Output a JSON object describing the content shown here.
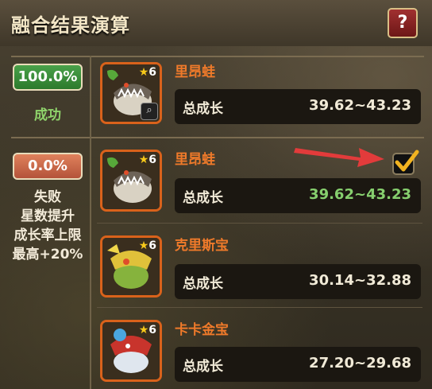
{
  "header": {
    "title": "融合结果演算",
    "help_label": "?"
  },
  "outcomes": [
    {
      "percent": "100.0%",
      "label": "成功"
    },
    {
      "percent": "0.0%",
      "label_lines": [
        "失败",
        "星数提升",
        "成长率上限",
        "最高+20%"
      ]
    }
  ],
  "pets": [
    {
      "name": "里昂蛙",
      "stars": "6",
      "stat_label": "总成长",
      "stat_value": "39.62~43.23",
      "color": "#ef7a2a"
    },
    {
      "name": "里昂蛙",
      "stars": "6",
      "stat_label": "总成长",
      "stat_value": "39.62~43.23",
      "value_color": "#86cf6e",
      "selected": true
    },
    {
      "name": "克里斯宝",
      "stars": "6",
      "stat_label": "总成长",
      "stat_value": "30.14~32.88"
    },
    {
      "name": "卡卡金宝",
      "stars": "6",
      "stat_label": "总成长",
      "stat_value": "27.20~29.68"
    }
  ],
  "colors": {
    "accent_orange": "#ef7a2a",
    "success_green": "#4aa14a",
    "fail_orange": "#d86f4c",
    "help_red": "#8e2222",
    "arrow_red": "#e23b3b"
  }
}
